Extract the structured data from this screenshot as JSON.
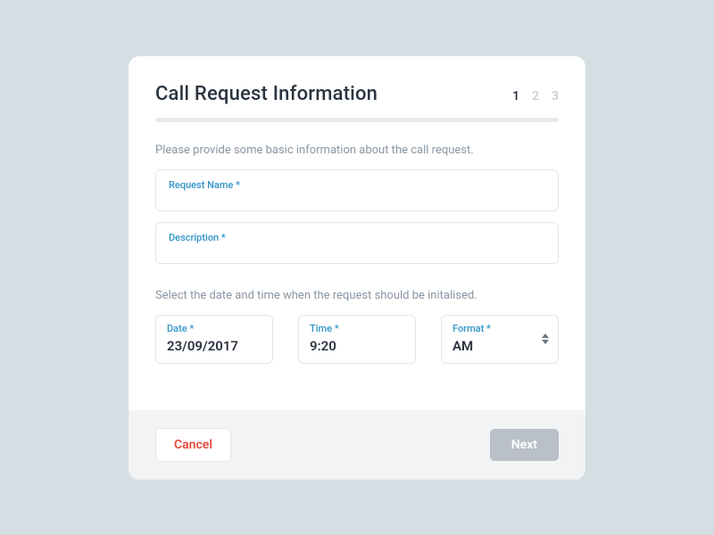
{
  "header": {
    "title": "Call Request Information"
  },
  "steps": {
    "s1": "1",
    "s2": "2",
    "s3": "3"
  },
  "intro": "Please provide some basic information about the call request.",
  "fields": {
    "requestName": {
      "label": "Request Name *",
      "value": ""
    },
    "description": {
      "label": "Description *",
      "value": ""
    }
  },
  "datetimeIntro": "Select the date and time when the request should be initalised.",
  "date": {
    "label": "Date *",
    "value": "23/09/2017"
  },
  "time": {
    "label": "Time *",
    "value": "9:20"
  },
  "format": {
    "label": "Format *",
    "value": "AM"
  },
  "actions": {
    "cancel": "Cancel",
    "next": "Next"
  }
}
